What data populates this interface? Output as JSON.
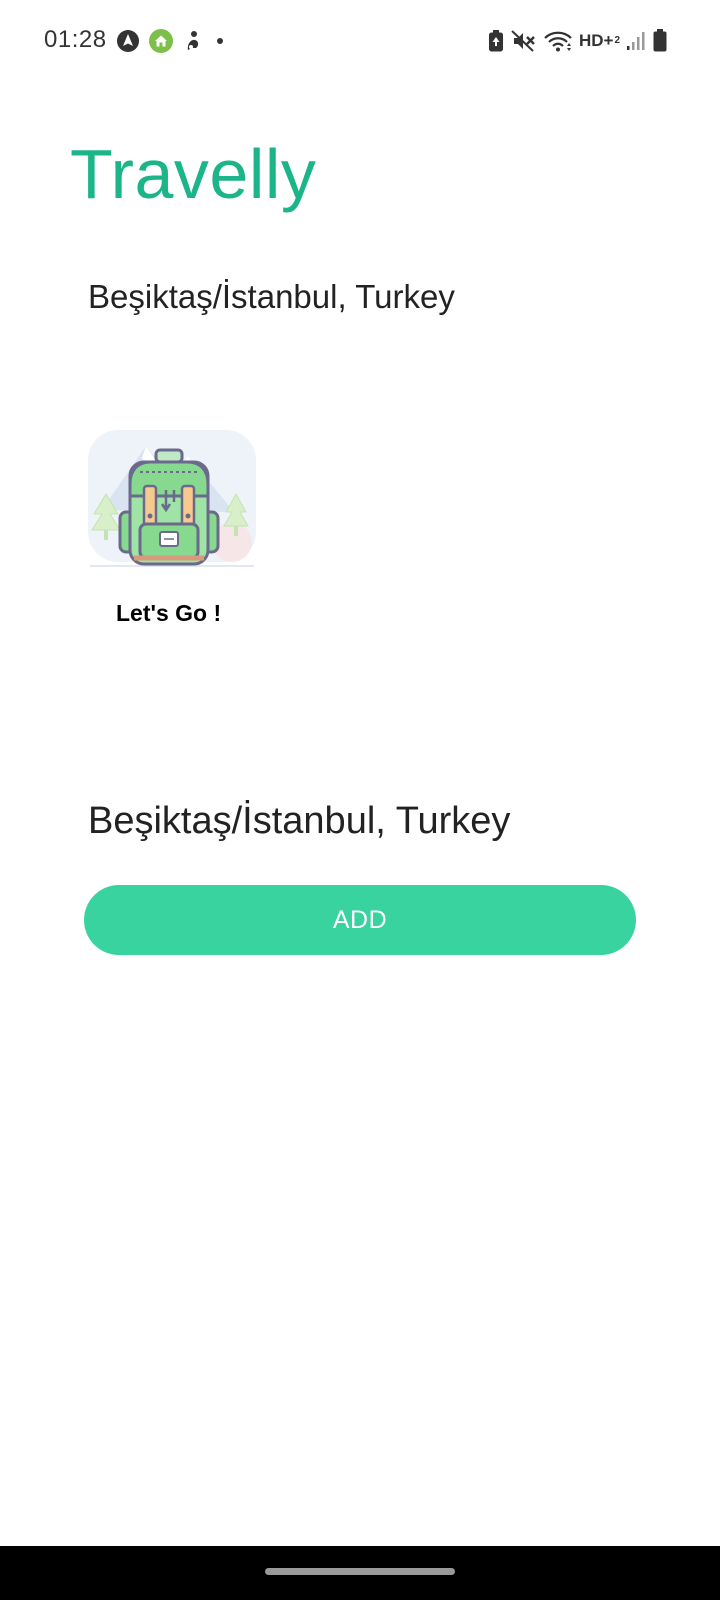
{
  "status_bar": {
    "time": "01:28",
    "left_icons": [
      "navigation-app-icon",
      "home-app-icon",
      "fitness-app-icon",
      "more-notifications-dot-icon"
    ],
    "network_label": "HD+",
    "network_sub": "2",
    "right_icons": [
      "battery-saver-icon",
      "mute-icon",
      "wifi-icon",
      "hd-network-icon",
      "signal-icon",
      "battery-icon"
    ]
  },
  "header": {
    "title": "Travelly"
  },
  "location": {
    "top_text": "Beşiktaş/İstanbul, Turkey",
    "bottom_text": "Beşiktaş/İstanbul, Turkey"
  },
  "card": {
    "image_icon": "backpack-icon",
    "label": "Let's Go !"
  },
  "actions": {
    "add_label": "ADD"
  },
  "colors": {
    "title": "#1cb489",
    "button": "#38d39e",
    "text": "#222222",
    "nav_bar": "#000000"
  }
}
